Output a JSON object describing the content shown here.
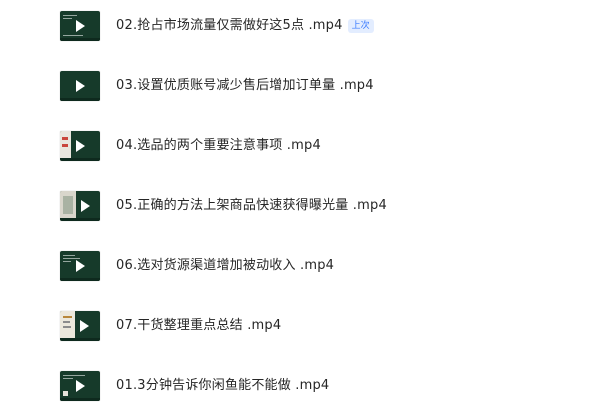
{
  "files": [
    {
      "name": "02.抢占市场流量仅需做好这5点 .mp4",
      "badge": "上次",
      "thumb": "dark"
    },
    {
      "name": "03.设置优质账号减少售后增加订单量 .mp4",
      "thumb": "dark"
    },
    {
      "name": "04.选品的两个重要注意事项 .mp4",
      "thumb": "split-red"
    },
    {
      "name": "05.正确的方法上架商品快速获得曝光量 .mp4",
      "thumb": "split-photo"
    },
    {
      "name": "06.选对货源渠道增加被动收入 .mp4",
      "thumb": "dark-lines"
    },
    {
      "name": "07.干货整理重点总结 .mp4",
      "thumb": "split-doc"
    },
    {
      "name": "01.3分钟告诉你闲鱼能不能做 .mp4",
      "thumb": "dark-lines"
    }
  ],
  "icons": {
    "thumbnail": "video-thumbnail-icon",
    "play": "play-icon"
  },
  "colors": {
    "thumbnail_bg": "#163a2a",
    "badge_text": "#3a7bff",
    "badge_bg": "#e3edff",
    "text": "#262626"
  }
}
